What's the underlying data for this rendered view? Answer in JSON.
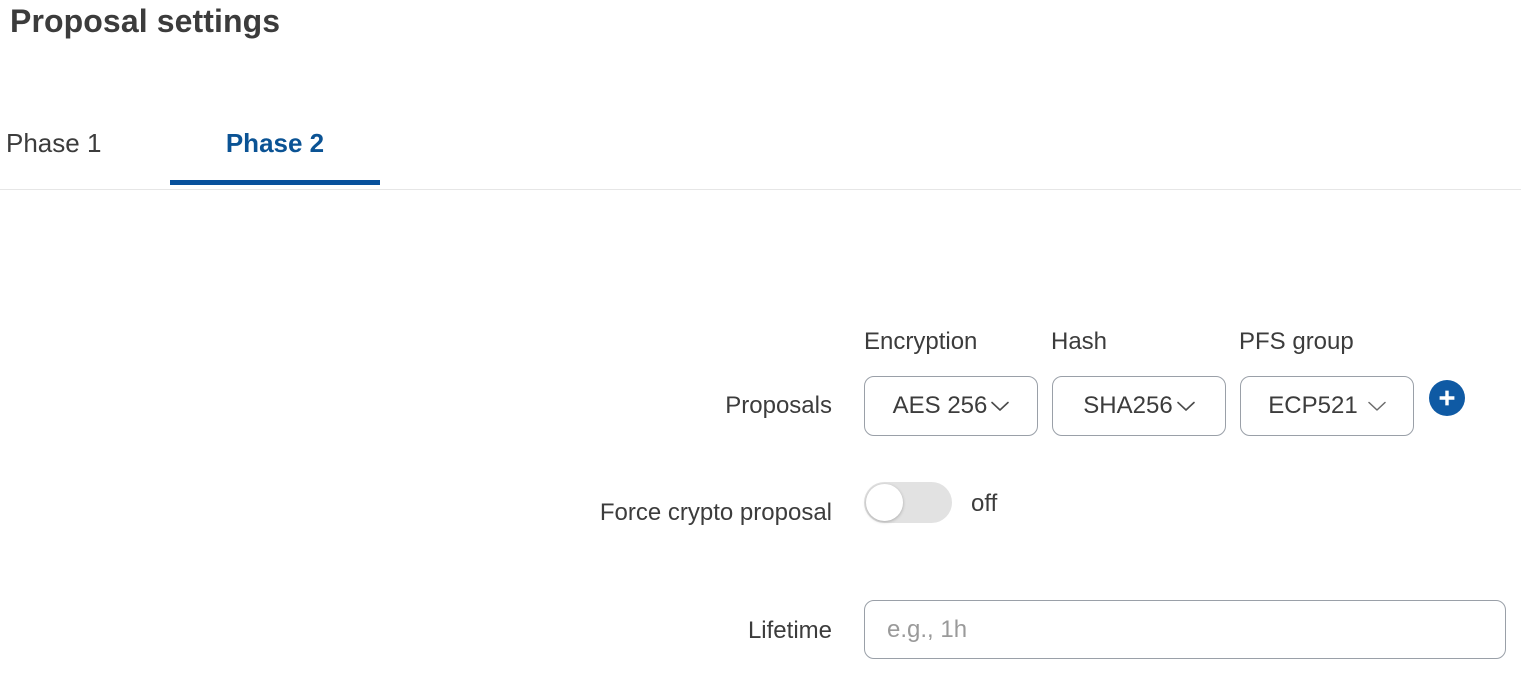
{
  "header": {
    "title": "Proposal settings"
  },
  "tabs": [
    {
      "label": "Phase 1",
      "active": false
    },
    {
      "label": "Phase 2",
      "active": true
    }
  ],
  "colors": {
    "accent_blue": "#0b5394",
    "tab_underline": "#08519c",
    "add_button": "#0f5aa4",
    "text": "#3c3c3c",
    "border": "#9aa0a8",
    "toggle_track_off": "#e2e2e2",
    "placeholder": "#9a9a9a"
  },
  "form": {
    "column_headers": {
      "encryption": "Encryption",
      "hash": "Hash",
      "pfs_group": "PFS group"
    },
    "proposals": {
      "label": "Proposals",
      "encryption_value": "AES 256",
      "hash_value": "SHA256",
      "pfs_group_value": "ECP521",
      "add_button_title": "Add proposal"
    },
    "force_crypto": {
      "label": "Force crypto proposal",
      "state": "off"
    },
    "lifetime": {
      "label": "Lifetime",
      "value": "",
      "placeholder": "e.g., 1h"
    }
  }
}
